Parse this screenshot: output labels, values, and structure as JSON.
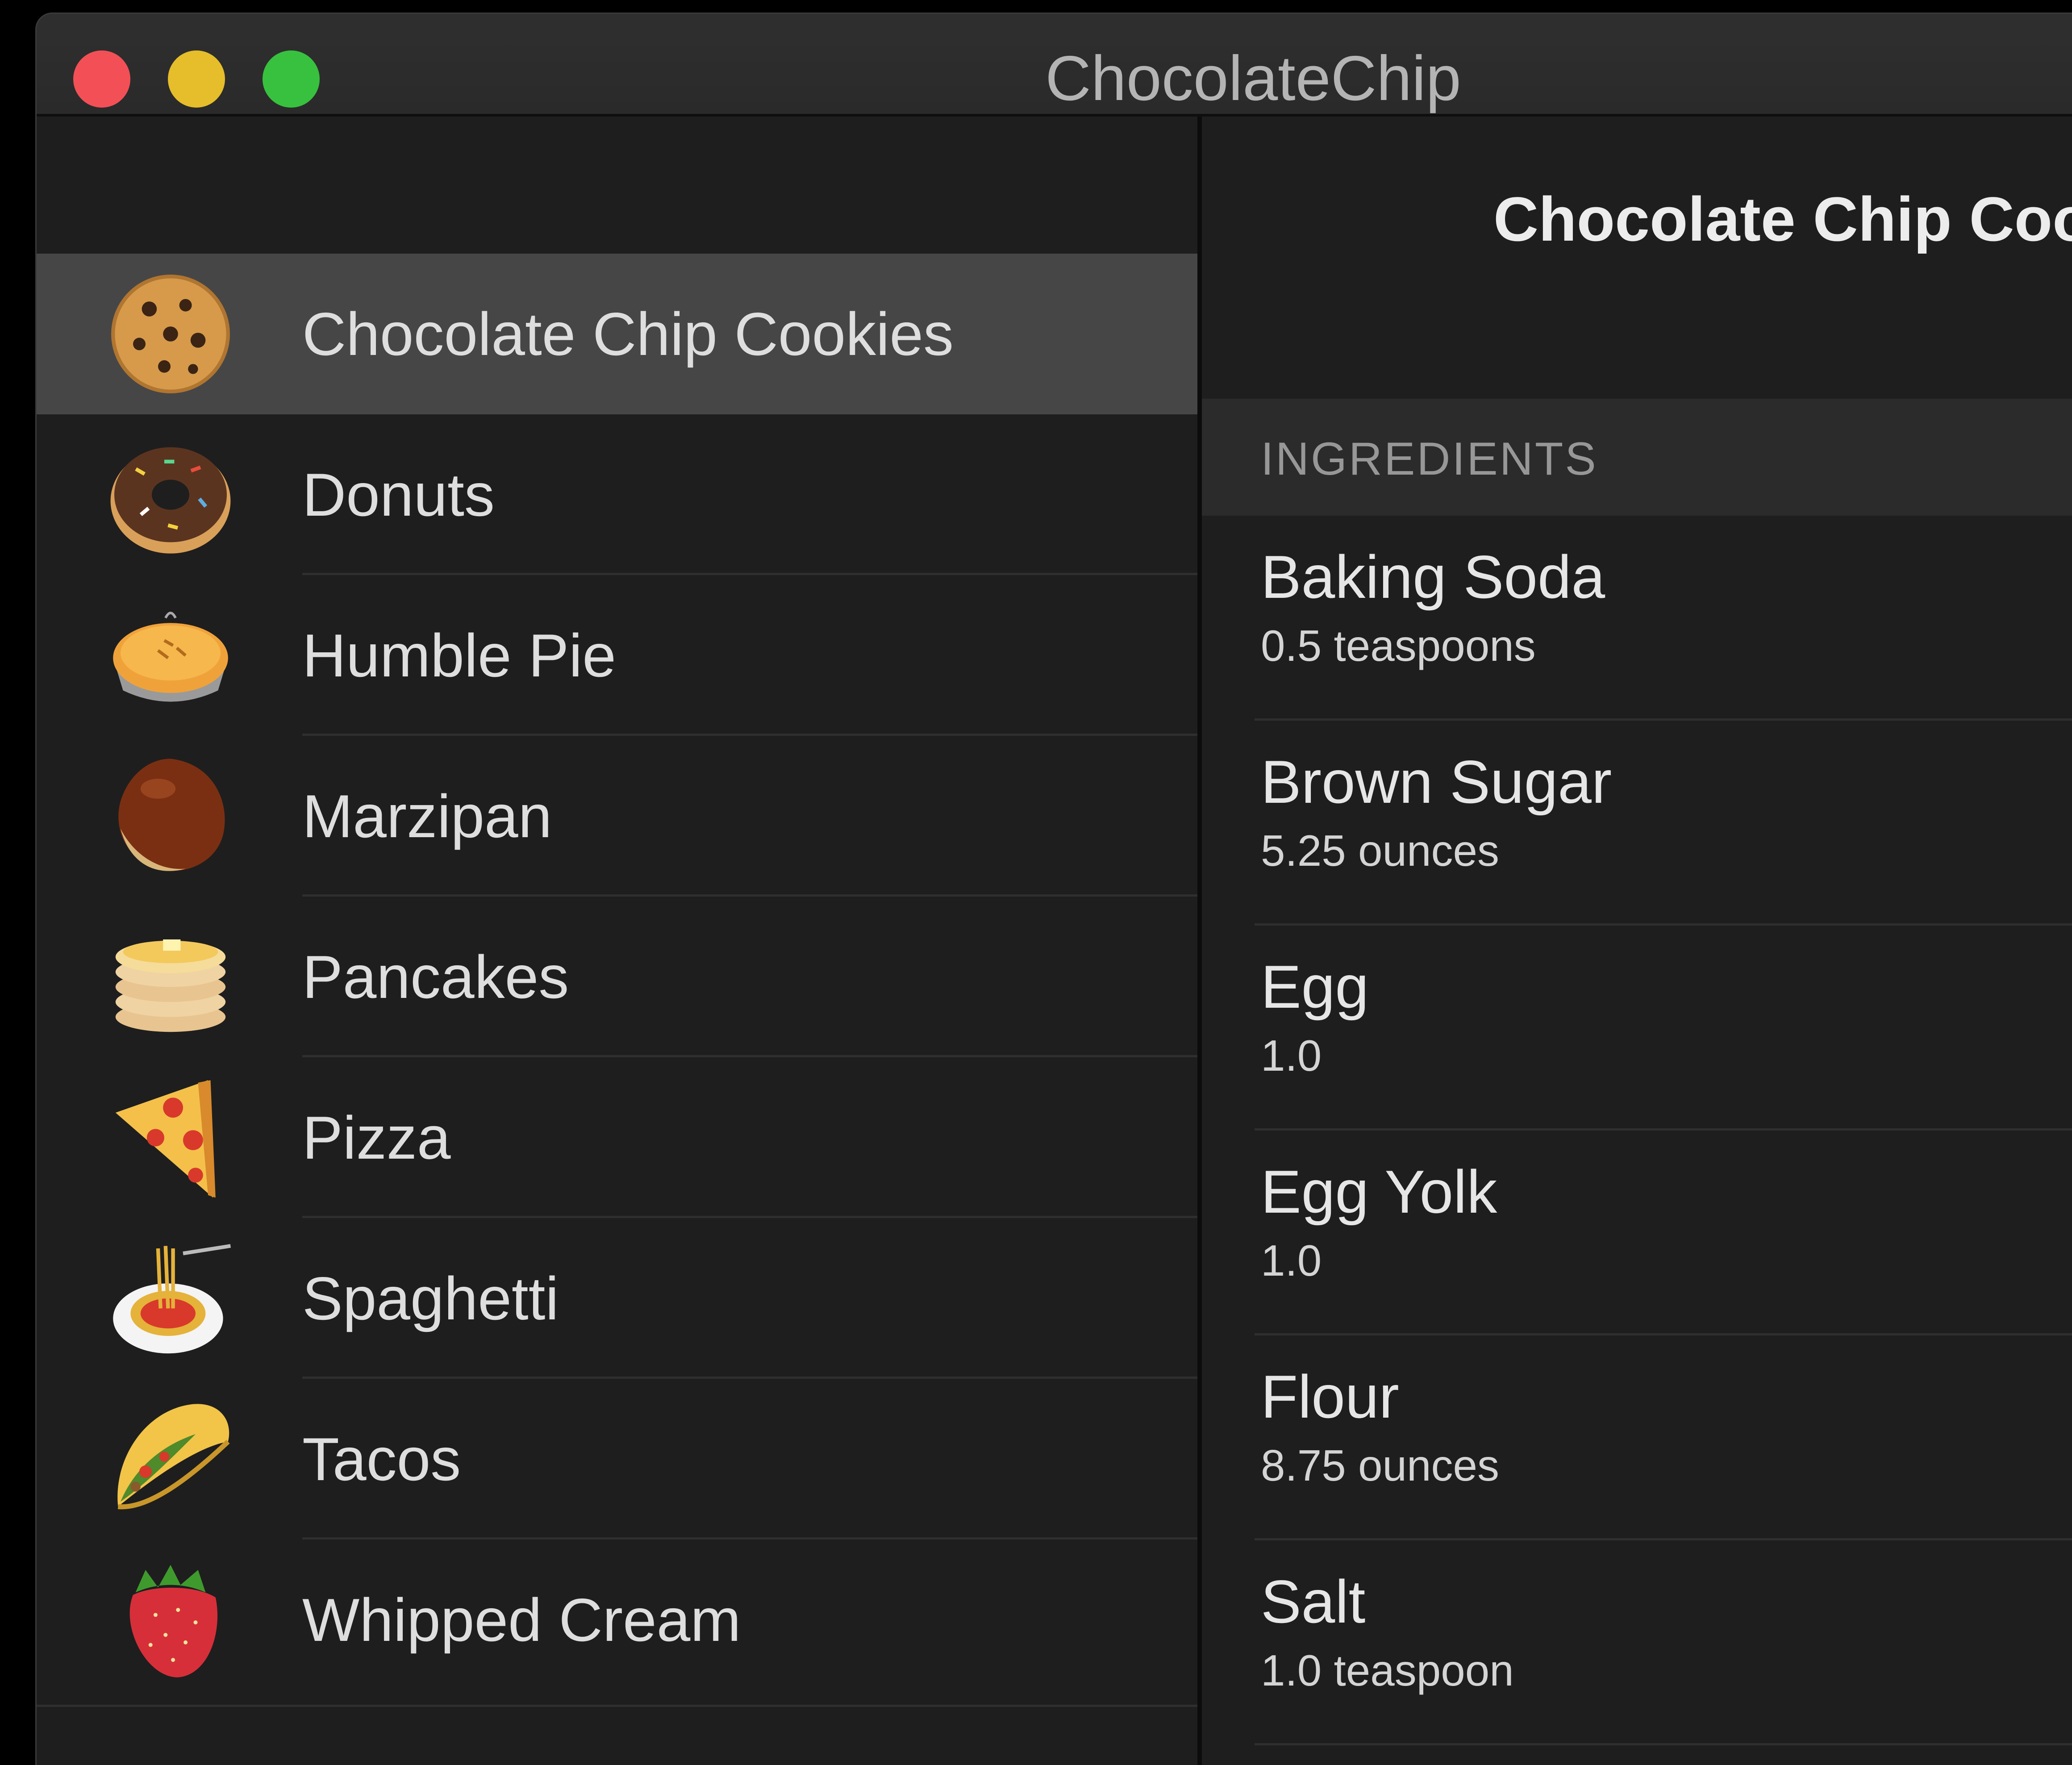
{
  "window": {
    "title": "ChocolateChip"
  },
  "sidebar": {
    "items": [
      {
        "label": "Chocolate Chip Cookies",
        "icon": "cookie-icon",
        "selected": true
      },
      {
        "label": "Donuts",
        "icon": "donut-icon",
        "selected": false
      },
      {
        "label": "Humble Pie",
        "icon": "pie-icon",
        "selected": false
      },
      {
        "label": "Marzipan",
        "icon": "chestnut-icon",
        "selected": false
      },
      {
        "label": "Pancakes",
        "icon": "pancakes-icon",
        "selected": false
      },
      {
        "label": "Pizza",
        "icon": "pizza-icon",
        "selected": false
      },
      {
        "label": "Spaghetti",
        "icon": "spaghetti-icon",
        "selected": false
      },
      {
        "label": "Tacos",
        "icon": "taco-icon",
        "selected": false
      },
      {
        "label": "Whipped Cream",
        "icon": "strawberry-icon",
        "selected": false
      }
    ]
  },
  "detail": {
    "title": "Chocolate Chip Coo",
    "section_header": "INGREDIENTS",
    "ingredients": [
      {
        "name": "Baking Soda",
        "amount": "0.5 teaspoons"
      },
      {
        "name": "Brown Sugar",
        "amount": "5.25 ounces"
      },
      {
        "name": "Egg",
        "amount": "1.0"
      },
      {
        "name": "Egg Yolk",
        "amount": "1.0"
      },
      {
        "name": "Flour",
        "amount": "8.75 ounces"
      },
      {
        "name": "Salt",
        "amount": "1.0 teaspoon"
      }
    ]
  },
  "colors": {
    "close": "#f25056",
    "minimize": "#e6bd2a",
    "maximize": "#38c13f",
    "selection": "#464646",
    "background": "#1e1e1e"
  }
}
